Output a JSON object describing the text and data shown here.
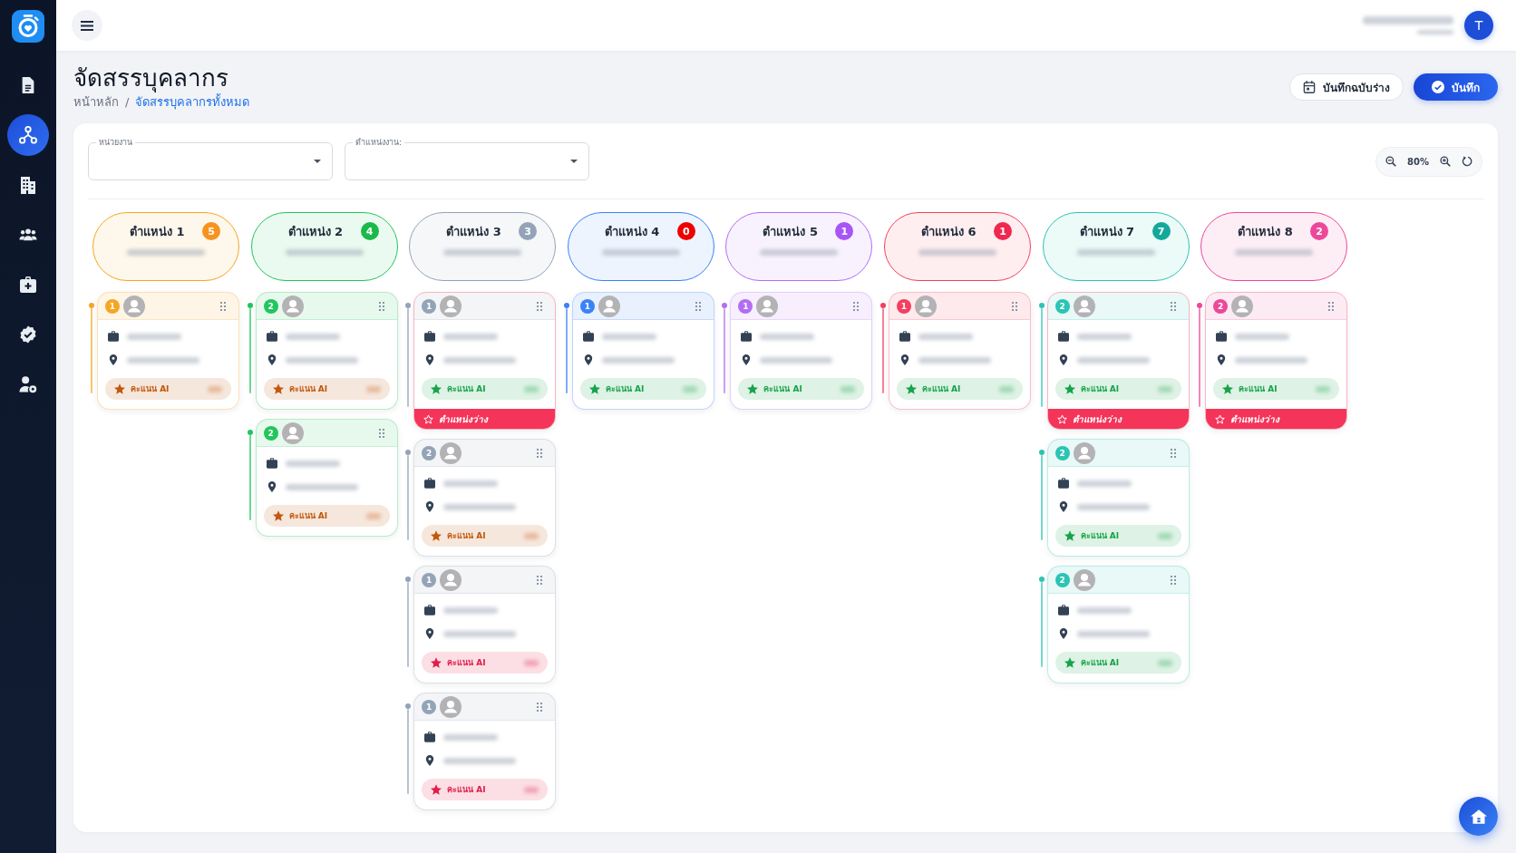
{
  "sidebar": {
    "items": [
      {
        "selected": false
      },
      {
        "selected": true
      },
      {
        "selected": false
      },
      {
        "selected": false
      },
      {
        "selected": false
      },
      {
        "selected": false
      },
      {
        "selected": false
      }
    ]
  },
  "topbar": {
    "avatar_initial": "T"
  },
  "page": {
    "title": "จัดสรรบุคลากร",
    "breadcrumb_separator": "/",
    "breadcrumb": [
      {
        "label": "หน้าหลัก",
        "selected": false
      },
      {
        "label": "จัดสรรบุคลากรทั้งหมด",
        "selected": true
      }
    ]
  },
  "actions": [
    {
      "label": "บันทึกฉบับร่าง",
      "kind": "secondary"
    },
    {
      "label": "บันทึก",
      "kind": "primary"
    }
  ],
  "filters": [
    {
      "label": "หน่วยงาน"
    },
    {
      "label": "ตำแหน่งงาน:"
    }
  ],
  "zoom": {
    "value": "80%"
  },
  "columns": [
    {
      "title": "ตำแหน่ง 1",
      "color": "#f5a623",
      "count": {
        "text": "5",
        "color": "#f7931e"
      },
      "cards": [
        {
          "rank": "1",
          "score": {
            "label": "คะแนน AI",
            "color": "#c2570c"
          },
          "vacant": false
        }
      ]
    },
    {
      "title": "ตำแหน่ง 2",
      "color": "#22c55e",
      "count": {
        "text": "4",
        "color": "#19b94a"
      },
      "cards": [
        {
          "rank": "2",
          "score": {
            "label": "คะแนน AI",
            "color": "#c2570c"
          },
          "vacant": false
        },
        {
          "rank": "2",
          "score": {
            "label": "คะแนน AI",
            "color": "#c2570c"
          },
          "vacant": false
        }
      ]
    },
    {
      "title": "ตำแหน่ง 3",
      "color": "#94a3b8",
      "count": {
        "text": "3",
        "color": "#94a3b8"
      },
      "cards": [
        {
          "rank": "1",
          "score": {
            "label": "คะแนน AI",
            "color": "#16a34a"
          },
          "vacant": true,
          "vacancy_label": "ตำแหน่งว่าง"
        },
        {
          "rank": "2",
          "score": {
            "label": "คะแนน AI",
            "color": "#c2570c"
          },
          "vacant": false
        },
        {
          "rank": "1",
          "score": {
            "label": "คะแนน AI",
            "color": "#e11d48"
          },
          "vacant": false
        },
        {
          "rank": "1",
          "score": {
            "label": "คะแนน AI",
            "color": "#e11d48"
          },
          "vacant": false
        }
      ]
    },
    {
      "title": "ตำแหน่ง 4",
      "color": "#3b82f6",
      "count": {
        "text": "0",
        "color": "#ee0000"
      },
      "cards": [
        {
          "rank": "1",
          "score": {
            "label": "คะแนน AI",
            "color": "#16a34a"
          },
          "vacant": false
        }
      ]
    },
    {
      "title": "ตำแหน่ง 5",
      "color": "#b36cf5",
      "count": {
        "text": "1",
        "color": "#a855f7"
      },
      "cards": [
        {
          "rank": "1",
          "score": {
            "label": "คะแนน AI",
            "color": "#16a34a"
          },
          "vacant": false
        }
      ]
    },
    {
      "title": "ตำแหน่ง 6",
      "color": "#f43f5e",
      "count": {
        "text": "1",
        "color": "#f0284f"
      },
      "cards": [
        {
          "rank": "1",
          "score": {
            "label": "คะแนน AI",
            "color": "#16a34a"
          },
          "vacant": false
        }
      ]
    },
    {
      "title": "ตำแหน่ง 7",
      "color": "#2cc4b4",
      "count": {
        "text": "7",
        "color": "#14a89a"
      },
      "cards": [
        {
          "rank": "2",
          "score": {
            "label": "คะแนน AI",
            "color": "#16a34a"
          },
          "vacant": true,
          "vacancy_label": "ตำแหน่งว่าง"
        },
        {
          "rank": "2",
          "score": {
            "label": "คะแนน AI",
            "color": "#16a34a"
          },
          "vacant": false
        },
        {
          "rank": "2",
          "score": {
            "label": "คะแนน AI",
            "color": "#16a34a"
          },
          "vacant": false
        }
      ]
    },
    {
      "title": "ตำแหน่ง 8",
      "color": "#ec4899",
      "count": {
        "text": "2",
        "color": "#ec4899"
      },
      "cards": [
        {
          "rank": "2",
          "score": {
            "label": "คะแนน AI",
            "color": "#16a34a"
          },
          "vacant": true,
          "vacancy_label": "ตำแหน่งว่าง"
        }
      ]
    }
  ]
}
